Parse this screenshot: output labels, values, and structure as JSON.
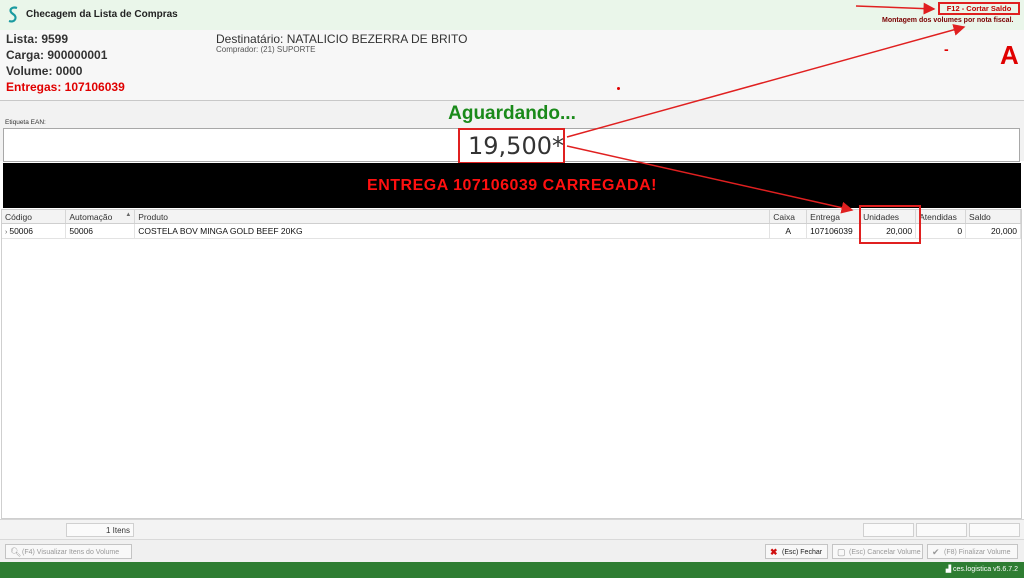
{
  "window": {
    "title": "Checagem da Lista de Compras"
  },
  "top_right": {
    "f12_label": "F12 - Cortar Saldo",
    "montagem_text": "Montagem dos volumes por nota fiscal.",
    "dash": "-",
    "big_letter": "A"
  },
  "header": {
    "lista": "Lista: 9599",
    "carga": "Carga: 900000001",
    "volume": "Volume: 0000",
    "entregas": "Entregas: 107106039",
    "destinatario": "Destinatário: NATALICIO BEZERRA DE BRITO",
    "comprador": "Comprador: (21) SUPORTE"
  },
  "status_text": "Aguardando...",
  "etiqueta_label": "Etiqueta EAN:",
  "ean_value": "19,500*",
  "banner": "ENTREGA   107106039   CARREGADA!",
  "table": {
    "columns": [
      "Código",
      "Automação",
      "Produto",
      "Caixa",
      "Entrega",
      "Unidades",
      "Atendidas",
      "Saldo"
    ],
    "rows": [
      {
        "row_marker": "›",
        "codigo": "50006",
        "automacao": "50006",
        "produto": "COSTELA BOV MINGA GOLD BEEF 20KG",
        "caixa": "A",
        "entrega": "107106039",
        "unidades": "20,000",
        "atendidas": "0",
        "saldo": "20,000"
      }
    ]
  },
  "items_count": "1 Itens",
  "buttons": {
    "visualizar": "(F4) Visualizar Itens do Volume",
    "fechar": "(Esc) Fechar",
    "cancelar": "(Esc) Cancelar Volume",
    "finalizar": "(F8) Finalizar Volume"
  },
  "version": "ces.logistica v5.6.7.2",
  "colors": {
    "accent_red": "#e00000",
    "status_green": "#1a8a1a",
    "footer_green": "#2e7d32"
  }
}
